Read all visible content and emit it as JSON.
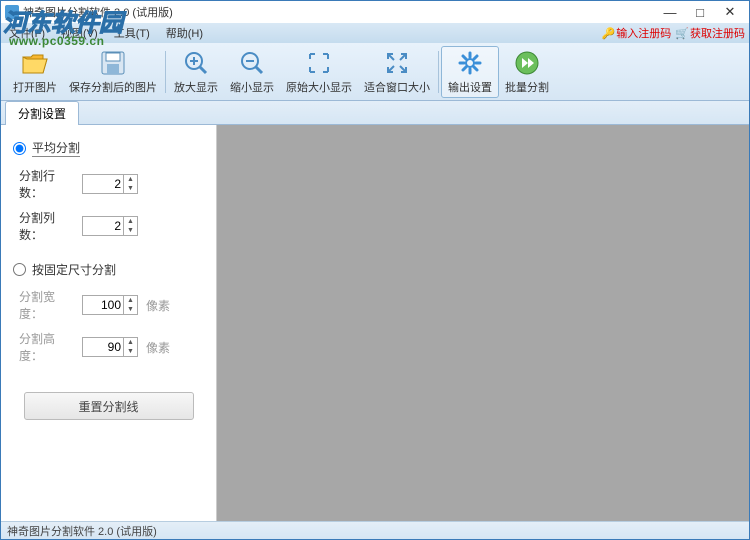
{
  "window": {
    "title": "神奇图片分割软件 2.0 (试用版)"
  },
  "menu": {
    "items": [
      {
        "label": "文件(F)"
      },
      {
        "label": "视图(V)"
      },
      {
        "label": "工具(T)"
      },
      {
        "label": "帮助(H)"
      }
    ]
  },
  "rightlinks": {
    "enter_code": "输入注册码",
    "get_code": "获取注册码"
  },
  "toolbar": {
    "open": "打开图片",
    "save": "保存分割后的图片",
    "zoom_in": "放大显示",
    "zoom_out": "缩小显示",
    "zoom_orig": "原始大小显示",
    "zoom_fit": "适合窗口大小",
    "output": "输出设置",
    "batch": "批量分割"
  },
  "tabs": {
    "split_settings": "分割设置"
  },
  "panel": {
    "avg_split": "平均分割",
    "rows_label": "分割行数：",
    "rows_value": "2",
    "cols_label": "分割列数：",
    "cols_value": "2",
    "fixed_split": "按固定尺寸分割",
    "width_label": "分割宽度：",
    "width_value": "100",
    "height_label": "分割高度：",
    "height_value": "90",
    "unit": "像素",
    "reset": "重置分割线"
  },
  "statusbar": {
    "text": "神奇图片分割软件 2.0 (试用版)"
  },
  "watermark": {
    "line1a": "河东",
    "line1b": "软件园",
    "url": "www.pc0359.cn"
  }
}
